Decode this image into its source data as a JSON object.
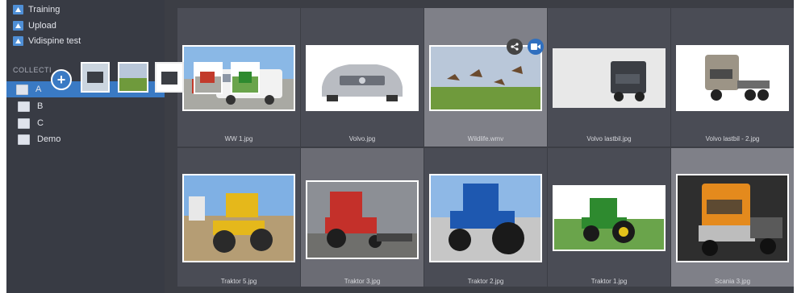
{
  "sidebar": {
    "items": [
      {
        "label": "Training",
        "icon": "media-app-icon"
      },
      {
        "label": "Upload",
        "icon": "media-app-icon"
      },
      {
        "label": "Vidispine test",
        "icon": "media-app-icon"
      }
    ],
    "collections_heading": "COLLECTI",
    "collections": [
      {
        "label": "A",
        "selected": true
      },
      {
        "label": "B",
        "selected": false
      },
      {
        "label": "C",
        "selected": false
      },
      {
        "label": "Demo",
        "selected": false
      }
    ],
    "add_to_collection_icon": "plus-icon"
  },
  "grid": {
    "row1": [
      {
        "caption": "WW 1.jpg",
        "icon": "truck-image"
      },
      {
        "caption": "Volvo.jpg",
        "icon": "car-image"
      },
      {
        "caption": "Wildlife.wmv",
        "icon": "birds-image"
      },
      {
        "caption": "Volvo lastbil.jpg",
        "icon": "truck-image"
      },
      {
        "caption": "Volvo lastbil - 2.jpg",
        "icon": "truck-image"
      }
    ],
    "row2": [
      {
        "caption": "Traktor 5.jpg",
        "icon": "loader-image"
      },
      {
        "caption": "Traktor 3.jpg",
        "icon": "tractor-image"
      },
      {
        "caption": "Traktor 2.jpg",
        "icon": "tractor-image"
      },
      {
        "caption": "Traktor 1.jpg",
        "icon": "tractor-image"
      },
      {
        "caption": "Scania 3.jpg",
        "icon": "truck-image"
      }
    ],
    "hover_actions": [
      "share-icon",
      "video-icon"
    ]
  },
  "colors": {
    "sidebar_bg": "#383b44",
    "selected": "#3a7ac4",
    "cell_bg": "#4a4c55",
    "cell_selected_bg": "#7f8088"
  }
}
